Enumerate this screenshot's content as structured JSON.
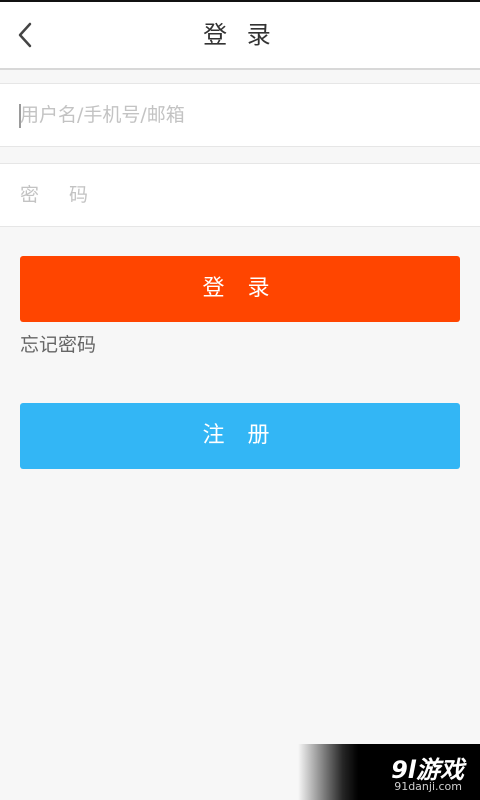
{
  "header": {
    "title": "登 录",
    "back_icon": "chevron-left-icon"
  },
  "form": {
    "username_placeholder": "用户名/手机号/邮箱",
    "password_placeholder": "密 码"
  },
  "buttons": {
    "login_label": "登 录",
    "forgot_label": "忘记密码",
    "register_label": "注 册"
  },
  "colors": {
    "login": "#ff4500",
    "register": "#33b6f5",
    "background": "#f7f7f7"
  },
  "watermark": {
    "logo": "9l游戏",
    "url": "91danji.com"
  }
}
